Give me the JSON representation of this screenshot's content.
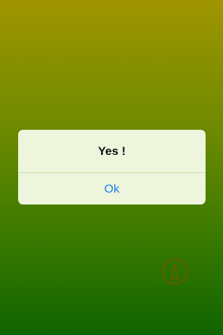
{
  "alert": {
    "title": "Yes !",
    "button_label": "Ok"
  },
  "icons": {
    "info": "info-icon"
  },
  "colors": {
    "background_top": "#a09500",
    "background_bottom": "#106400",
    "dialog_background": "#edf5dc",
    "button_text": "#1a82f0",
    "info_icon": "#6b5a00"
  }
}
